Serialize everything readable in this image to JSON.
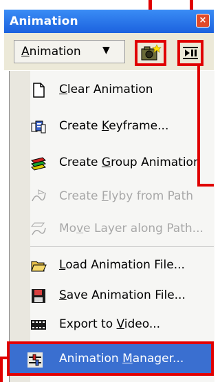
{
  "window": {
    "title": "Animation",
    "close_glyph": "×"
  },
  "toolbar": {
    "dropdown_label": "Animation",
    "dropdown_arrow": "▼",
    "camera_icon": "camera-keyframe-icon",
    "play_icon": "play-pause-icon"
  },
  "menu": {
    "items": [
      {
        "label": "Clear Animation",
        "accel": "C",
        "icon": "clear-page-icon",
        "enabled": true
      },
      {
        "label": "Create Keyframe...",
        "accel": "K",
        "icon": "create-keyframe-icon",
        "enabled": true
      },
      {
        "label": "Create Group Animation",
        "accel": "G",
        "icon": "group-animation-icon",
        "enabled": true
      },
      {
        "label": "Create Flyby from Path",
        "accel": "F",
        "icon": "flyby-path-icon",
        "enabled": false
      },
      {
        "label": "Move Layer along Path...",
        "accel": "v",
        "icon": "move-layer-path-icon",
        "enabled": false
      },
      {
        "label": "Load Animation File...",
        "accel": "L",
        "icon": "folder-open-icon",
        "enabled": true
      },
      {
        "label": "Save Animation File...",
        "accel": "S",
        "icon": "save-disk-icon",
        "enabled": true
      },
      {
        "label": "Export to Video...",
        "accel": "V",
        "icon": "film-strip-icon",
        "enabled": true
      },
      {
        "label": "Animation Manager...",
        "accel": "M",
        "icon": "animation-manager-icon",
        "enabled": true,
        "highlighted": true
      }
    ]
  },
  "colors": {
    "title_bar": "#1c62de",
    "highlight_bg": "#3a6fd0",
    "callout_red": "#e00000",
    "disabled_text": "#a8a8a8"
  }
}
